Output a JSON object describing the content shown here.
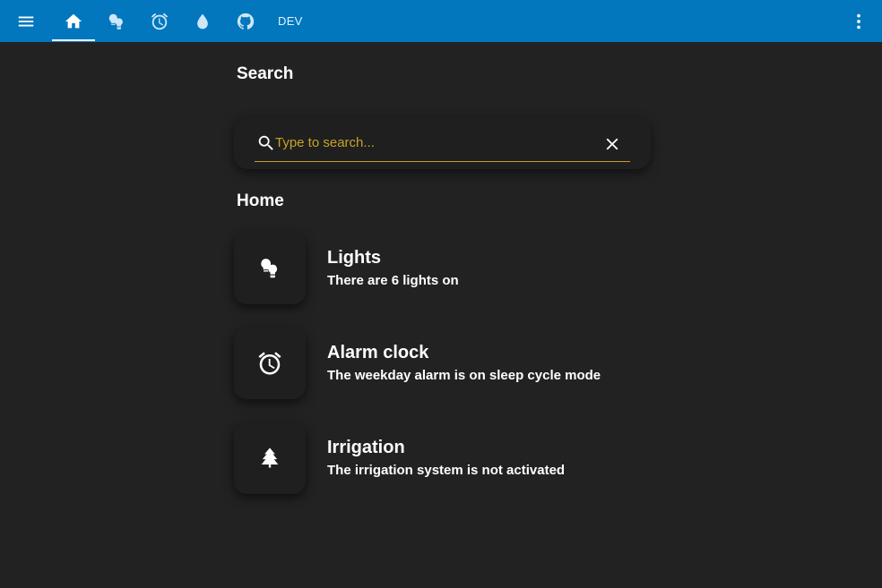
{
  "topbar": {
    "menu_icon": "menu-icon",
    "tabs": [
      {
        "icon": "home-icon",
        "active": true
      },
      {
        "icon": "lightbulbs-icon"
      },
      {
        "icon": "alarm-clock-icon"
      },
      {
        "icon": "water-drop-icon"
      },
      {
        "icon": "github-icon"
      }
    ],
    "dev_label": "DEV",
    "more_icon": "more-vertical-icon",
    "color": "#0277bd"
  },
  "search": {
    "title": "Search",
    "placeholder": "Type to search...",
    "value": "",
    "accent_color": "#c9a227"
  },
  "home": {
    "title": "Home",
    "items": [
      {
        "icon": "lightbulbs-icon",
        "title": "Lights",
        "subtitle": "There are 6 lights on"
      },
      {
        "icon": "alarm-clock-icon",
        "title": "Alarm clock",
        "subtitle": "The weekday alarm is on sleep cycle mode"
      },
      {
        "icon": "pine-tree-icon",
        "title": "Irrigation",
        "subtitle": "The irrigation system is not activated"
      }
    ]
  }
}
